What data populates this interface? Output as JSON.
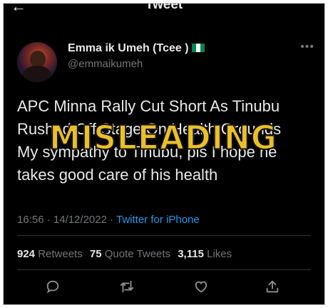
{
  "header": {
    "title": "Tweet"
  },
  "author": {
    "display_name": "Emma ik Umeh (Tcee )",
    "handle": "@emmaikumeh"
  },
  "tweet": {
    "text": "APC Minna Rally Cut Short As Tinubu Rushed Off Stage On Health Grounds\nMy sympathy to Tinubu, pls I hope he takes good care of his health"
  },
  "overlay": {
    "stamp": "MISLEADING",
    "color": "#e8c02a"
  },
  "meta": {
    "time_date": "16:56 · 14/12/2022 · ",
    "source": "Twitter for iPhone"
  },
  "stats": {
    "retweets_count": "924",
    "retweets_label": "Retweets",
    "quotes_count": "75",
    "quotes_label": "Quote Tweets",
    "likes_count": "3,115",
    "likes_label": "Likes"
  },
  "colors": {
    "background": "#000000",
    "text": "#e7e9ea",
    "muted": "#71767b",
    "link": "#1d9bf0"
  },
  "icons": [
    "back-arrow-icon",
    "more-icon",
    "reply-icon",
    "retweet-icon",
    "like-icon",
    "share-icon",
    "nigeria-flag-icon"
  ]
}
